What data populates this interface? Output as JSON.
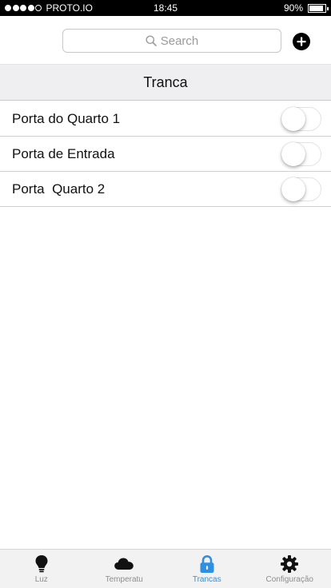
{
  "status_bar": {
    "carrier": "PROTO.IO",
    "time": "18:45",
    "battery": "90%",
    "battery_level": 0.9,
    "signal_bars": 4,
    "signal_total": 5
  },
  "search": {
    "placeholder": "Search"
  },
  "section": {
    "title": "Tranca"
  },
  "locks": [
    {
      "label": "Porta do Quarto 1",
      "on": false
    },
    {
      "label": "Porta de Entrada",
      "on": false
    },
    {
      "label": "Porta  Quarto 2",
      "on": false
    }
  ],
  "tabs": [
    {
      "label": "Luz",
      "icon": "bulb-icon",
      "active": false
    },
    {
      "label": "Temperatu",
      "icon": "cloud-icon",
      "active": false
    },
    {
      "label": "Trancas",
      "icon": "lock-icon",
      "active": true
    },
    {
      "label": "Configuração",
      "icon": "gear-icon",
      "active": false
    }
  ],
  "colors": {
    "accent": "#2f8fe0",
    "tab_inactive": "#8e8e8e",
    "section_bg": "#efeff1"
  }
}
